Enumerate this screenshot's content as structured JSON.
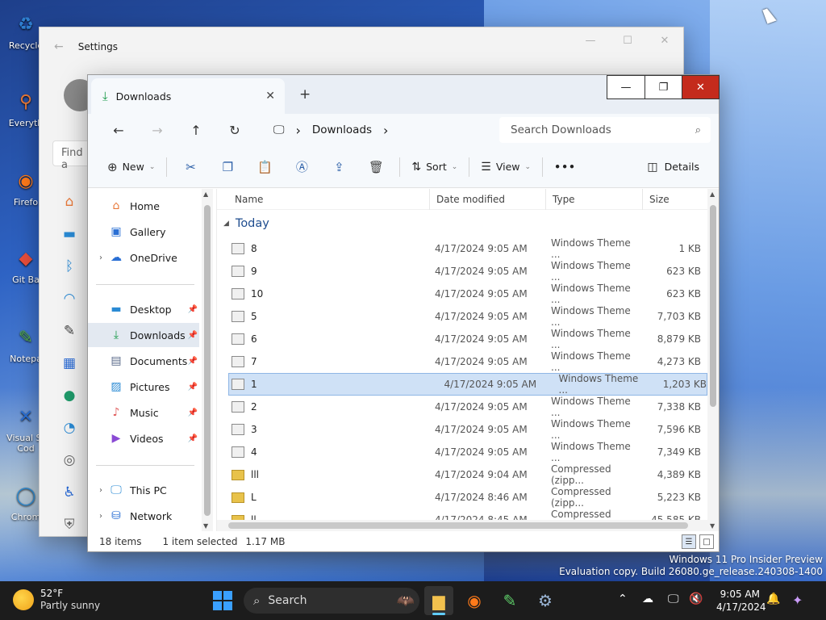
{
  "desktop": {
    "icons": [
      {
        "label": "Recycle",
        "glyph": "♻"
      },
      {
        "label": "Everyth",
        "glyph": "⚲"
      },
      {
        "label": "Firefo",
        "glyph": "◉"
      },
      {
        "label": "Git Ba",
        "glyph": "◆"
      },
      {
        "label": "Notepa",
        "glyph": "✎"
      },
      {
        "label": "Visual St Cod",
        "glyph": "✕"
      },
      {
        "label": "Chrom",
        "glyph": "◯"
      }
    ],
    "watermark": {
      "line1": "Windows 11 Pro Insider Preview",
      "line2": "Evaluation copy. Build 26080.ge_release.240308-1400"
    }
  },
  "settings": {
    "title": "Settings",
    "back": "←",
    "minimize": "—",
    "maximize": "☐",
    "close": "✕",
    "find_placeholder": "Find a"
  },
  "explorer": {
    "tab": {
      "label": "Downloads",
      "icon": "⤓",
      "close": "✕"
    },
    "new_tab": "+",
    "controls": {
      "minimize": "—",
      "maximize": "❐",
      "close": "✕"
    },
    "nav": {
      "back": "←",
      "forward": "→",
      "up": "↑",
      "refresh": "↻"
    },
    "breadcrumb": {
      "pc_icon": "🖵",
      "sep1": "›",
      "folder": "Downloads",
      "sep2": "›"
    },
    "search_placeholder": "Search Downloads",
    "search_icon": "⌕",
    "commands": {
      "new": "New",
      "sort": "Sort",
      "view": "View",
      "more": "•••",
      "details": "Details",
      "dropdown": "⌄"
    },
    "sidebar": {
      "items": [
        {
          "label": "Home",
          "icon": "⌂",
          "chev": ""
        },
        {
          "label": "Gallery",
          "icon": "▣",
          "chev": ""
        },
        {
          "label": "OneDrive",
          "icon": "☁",
          "chev": "›"
        },
        {
          "label": "Desktop",
          "icon": "▬",
          "chev": "",
          "pin": "📌"
        },
        {
          "label": "Downloads",
          "icon": "⤓",
          "chev": "",
          "pin": "📌"
        },
        {
          "label": "Documents",
          "icon": "▤",
          "chev": "",
          "pin": "📌"
        },
        {
          "label": "Pictures",
          "icon": "▨",
          "chev": "",
          "pin": "📌"
        },
        {
          "label": "Music",
          "icon": "♪",
          "chev": "",
          "pin": "📌"
        },
        {
          "label": "Videos",
          "icon": "▶",
          "chev": "",
          "pin": "📌"
        },
        {
          "label": "This PC",
          "icon": "🖵",
          "chev": "›"
        },
        {
          "label": "Network",
          "icon": "⛁",
          "chev": "›"
        }
      ]
    },
    "columns": {
      "name": "Name",
      "date": "Date modified",
      "type": "Type",
      "size": "Size"
    },
    "group": "Today",
    "files": [
      {
        "name": "8",
        "date": "4/17/2024 9:05 AM",
        "type": "Windows Theme ...",
        "size": "1 KB",
        "kind": "theme"
      },
      {
        "name": "9",
        "date": "4/17/2024 9:05 AM",
        "type": "Windows Theme ...",
        "size": "623 KB",
        "kind": "theme"
      },
      {
        "name": "10",
        "date": "4/17/2024 9:05 AM",
        "type": "Windows Theme ...",
        "size": "623 KB",
        "kind": "theme"
      },
      {
        "name": "5",
        "date": "4/17/2024 9:05 AM",
        "type": "Windows Theme ...",
        "size": "7,703 KB",
        "kind": "theme"
      },
      {
        "name": "6",
        "date": "4/17/2024 9:05 AM",
        "type": "Windows Theme ...",
        "size": "8,879 KB",
        "kind": "theme"
      },
      {
        "name": "7",
        "date": "4/17/2024 9:05 AM",
        "type": "Windows Theme ...",
        "size": "4,273 KB",
        "kind": "theme"
      },
      {
        "name": "1",
        "date": "4/17/2024 9:05 AM",
        "type": "Windows Theme ...",
        "size": "1,203 KB",
        "kind": "theme",
        "selected": true
      },
      {
        "name": "2",
        "date": "4/17/2024 9:05 AM",
        "type": "Windows Theme ...",
        "size": "7,338 KB",
        "kind": "theme"
      },
      {
        "name": "3",
        "date": "4/17/2024 9:05 AM",
        "type": "Windows Theme ...",
        "size": "7,596 KB",
        "kind": "theme"
      },
      {
        "name": "4",
        "date": "4/17/2024 9:05 AM",
        "type": "Windows Theme ...",
        "size": "7,349 KB",
        "kind": "theme"
      },
      {
        "name": "lll",
        "date": "4/17/2024 9:04 AM",
        "type": "Compressed (zipp...",
        "size": "4,389 KB",
        "kind": "zip"
      },
      {
        "name": "L",
        "date": "4/17/2024 8:46 AM",
        "type": "Compressed (zipp...",
        "size": "5,223 KB",
        "kind": "zip"
      },
      {
        "name": "ll",
        "date": "4/17/2024 8:45 AM",
        "type": "Compressed (zipp...",
        "size": "45,585 KB",
        "kind": "zip"
      }
    ],
    "status": {
      "count": "18 items",
      "selected": "1 item selected",
      "size": "1.17 MB"
    }
  },
  "taskbar": {
    "weather": {
      "temp": "52°F",
      "desc": "Partly sunny"
    },
    "search_label": "Search",
    "clock": {
      "time": "9:05 AM",
      "date": "4/17/2024"
    },
    "apps": [
      {
        "name": "file-explorer",
        "glyph": "📁"
      },
      {
        "name": "firefox",
        "glyph": "◉"
      },
      {
        "name": "paint",
        "glyph": "✎"
      },
      {
        "name": "settings",
        "glyph": "⚙"
      }
    ]
  },
  "colors": {
    "accent": "#0067c0",
    "close_red": "#c42b1c",
    "selection": "#cfe1f6"
  }
}
